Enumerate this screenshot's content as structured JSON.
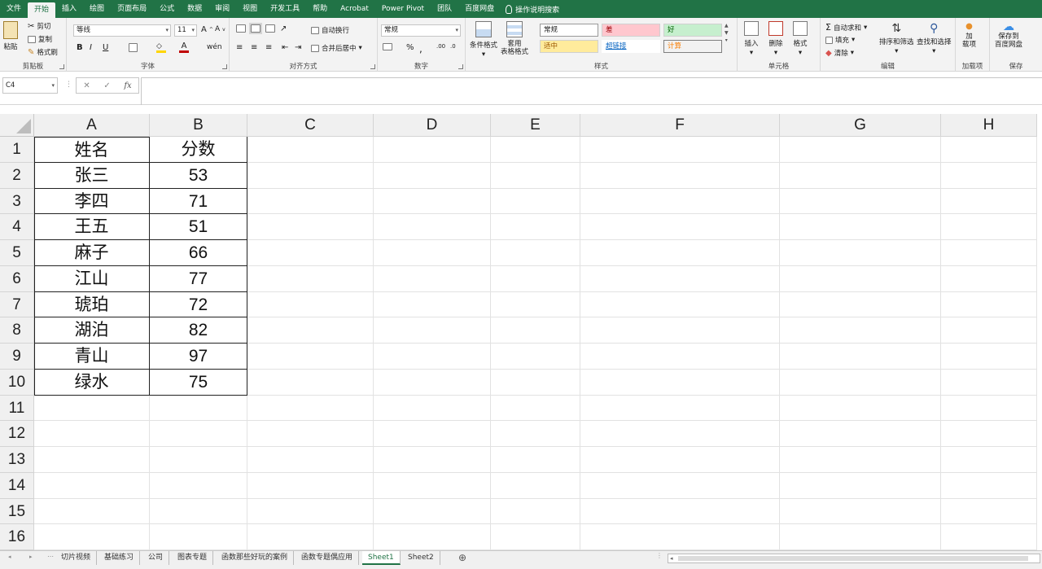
{
  "ribbon_tabs": [
    "文件",
    "开始",
    "插入",
    "绘图",
    "页面布局",
    "公式",
    "数据",
    "审阅",
    "视图",
    "开发工具",
    "帮助",
    "Acrobat",
    "Power Pivot",
    "团队",
    "百度网盘"
  ],
  "tell_me": "操作说明搜索",
  "clipboard": {
    "paste": "粘贴",
    "cut": "剪切",
    "copy": "复制",
    "format_painter": "格式刷",
    "label": "剪贴板"
  },
  "font": {
    "family": "等线",
    "size": "11",
    "label": "字体"
  },
  "alignment": {
    "wrap": "自动换行",
    "merge": "合并后居中",
    "label": "对齐方式"
  },
  "number": {
    "format": "常规",
    "label": "数字"
  },
  "styles": {
    "cond_format": "条件格式",
    "table_format": "套用\n表格格式",
    "normal": "常规",
    "bad": "差",
    "good": "好",
    "neutral": "适中",
    "hyperlink": "超链接",
    "calc": "计算",
    "label": "样式"
  },
  "cells": {
    "insert": "插入",
    "delete": "删除",
    "format": "格式",
    "label": "单元格"
  },
  "editing": {
    "autosum": "自动求和",
    "fill": "填充",
    "clear": "清除",
    "sort": "排序和筛选",
    "find": "查找和选择",
    "label": "编辑"
  },
  "addins": {
    "btn": "加\n载项",
    "label": "加载项"
  },
  "save": {
    "btn": "保存到\n百度网盘",
    "label": "保存"
  },
  "name_box": "C4",
  "fx": "fx",
  "columns": [
    "A",
    "B",
    "C",
    "D",
    "E",
    "F",
    "G",
    "H"
  ],
  "rows": [
    "1",
    "2",
    "3",
    "4",
    "5",
    "6",
    "7",
    "8",
    "9",
    "10",
    "11",
    "12",
    "13",
    "14",
    "15",
    "16"
  ],
  "table": {
    "header": [
      "姓名",
      "分数"
    ],
    "data": [
      [
        "张三",
        "53"
      ],
      [
        "李四",
        "71"
      ],
      [
        "王五",
        "51"
      ],
      [
        "麻子",
        "66"
      ],
      [
        "江山",
        "77"
      ],
      [
        "琥珀",
        "72"
      ],
      [
        "湖泊",
        "82"
      ],
      [
        "青山",
        "97"
      ],
      [
        "绿水",
        "75"
      ]
    ]
  },
  "sheets": [
    "切片视频",
    "基础练习",
    "公司",
    "图表专题",
    "函数那些好玩的案例",
    "函数专题偶应用",
    "Sheet1",
    "Sheet2"
  ],
  "active_sheet": "Sheet1",
  "accent": "#217346"
}
